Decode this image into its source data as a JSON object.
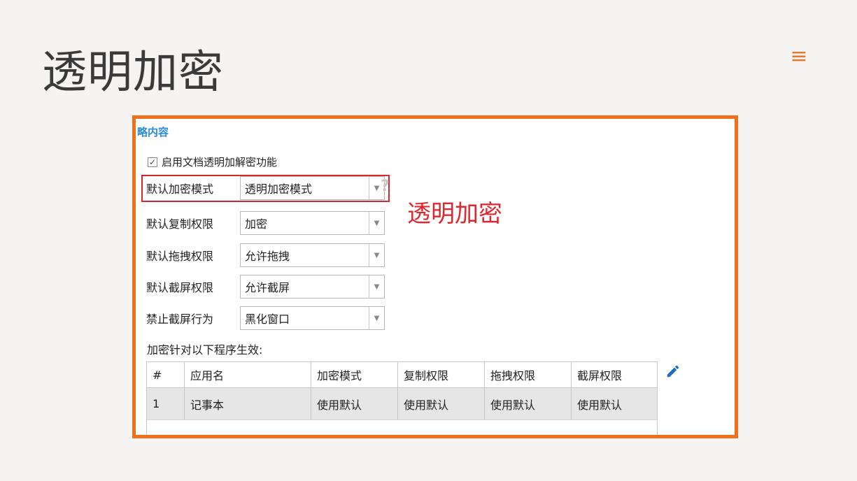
{
  "page": {
    "title": "透明加密",
    "menu_icon": "hamburger-menu-icon"
  },
  "panel": {
    "section_title": "略内容",
    "enable_checkbox": {
      "checked": true,
      "label": "启用文档透明加解密功能"
    },
    "fields": [
      {
        "label": "默认加密模式",
        "value": "透明加密模式"
      },
      {
        "label": "默认复制权限",
        "value": "加密"
      },
      {
        "label": "默认拖拽权限",
        "value": "允许拖拽"
      },
      {
        "label": "默认截屏权限",
        "value": "允许截屏"
      },
      {
        "label": "禁止截屏行为",
        "value": "黑化窗口"
      }
    ],
    "annotation": "透明加密",
    "program_note": "加密针对以下程序生效:",
    "table": {
      "headers": [
        "#",
        "应用名",
        "加密模式",
        "复制权限",
        "拖拽权限",
        "截屏权限"
      ],
      "rows": [
        [
          "1",
          "记事本",
          "使用默认",
          "使用默认",
          "使用默认",
          "使用默认"
        ]
      ]
    }
  },
  "colors": {
    "accent": "#f0701b",
    "highlight": "#d9262e",
    "link": "#2a8ad8",
    "edit": "#1a6fc9"
  }
}
